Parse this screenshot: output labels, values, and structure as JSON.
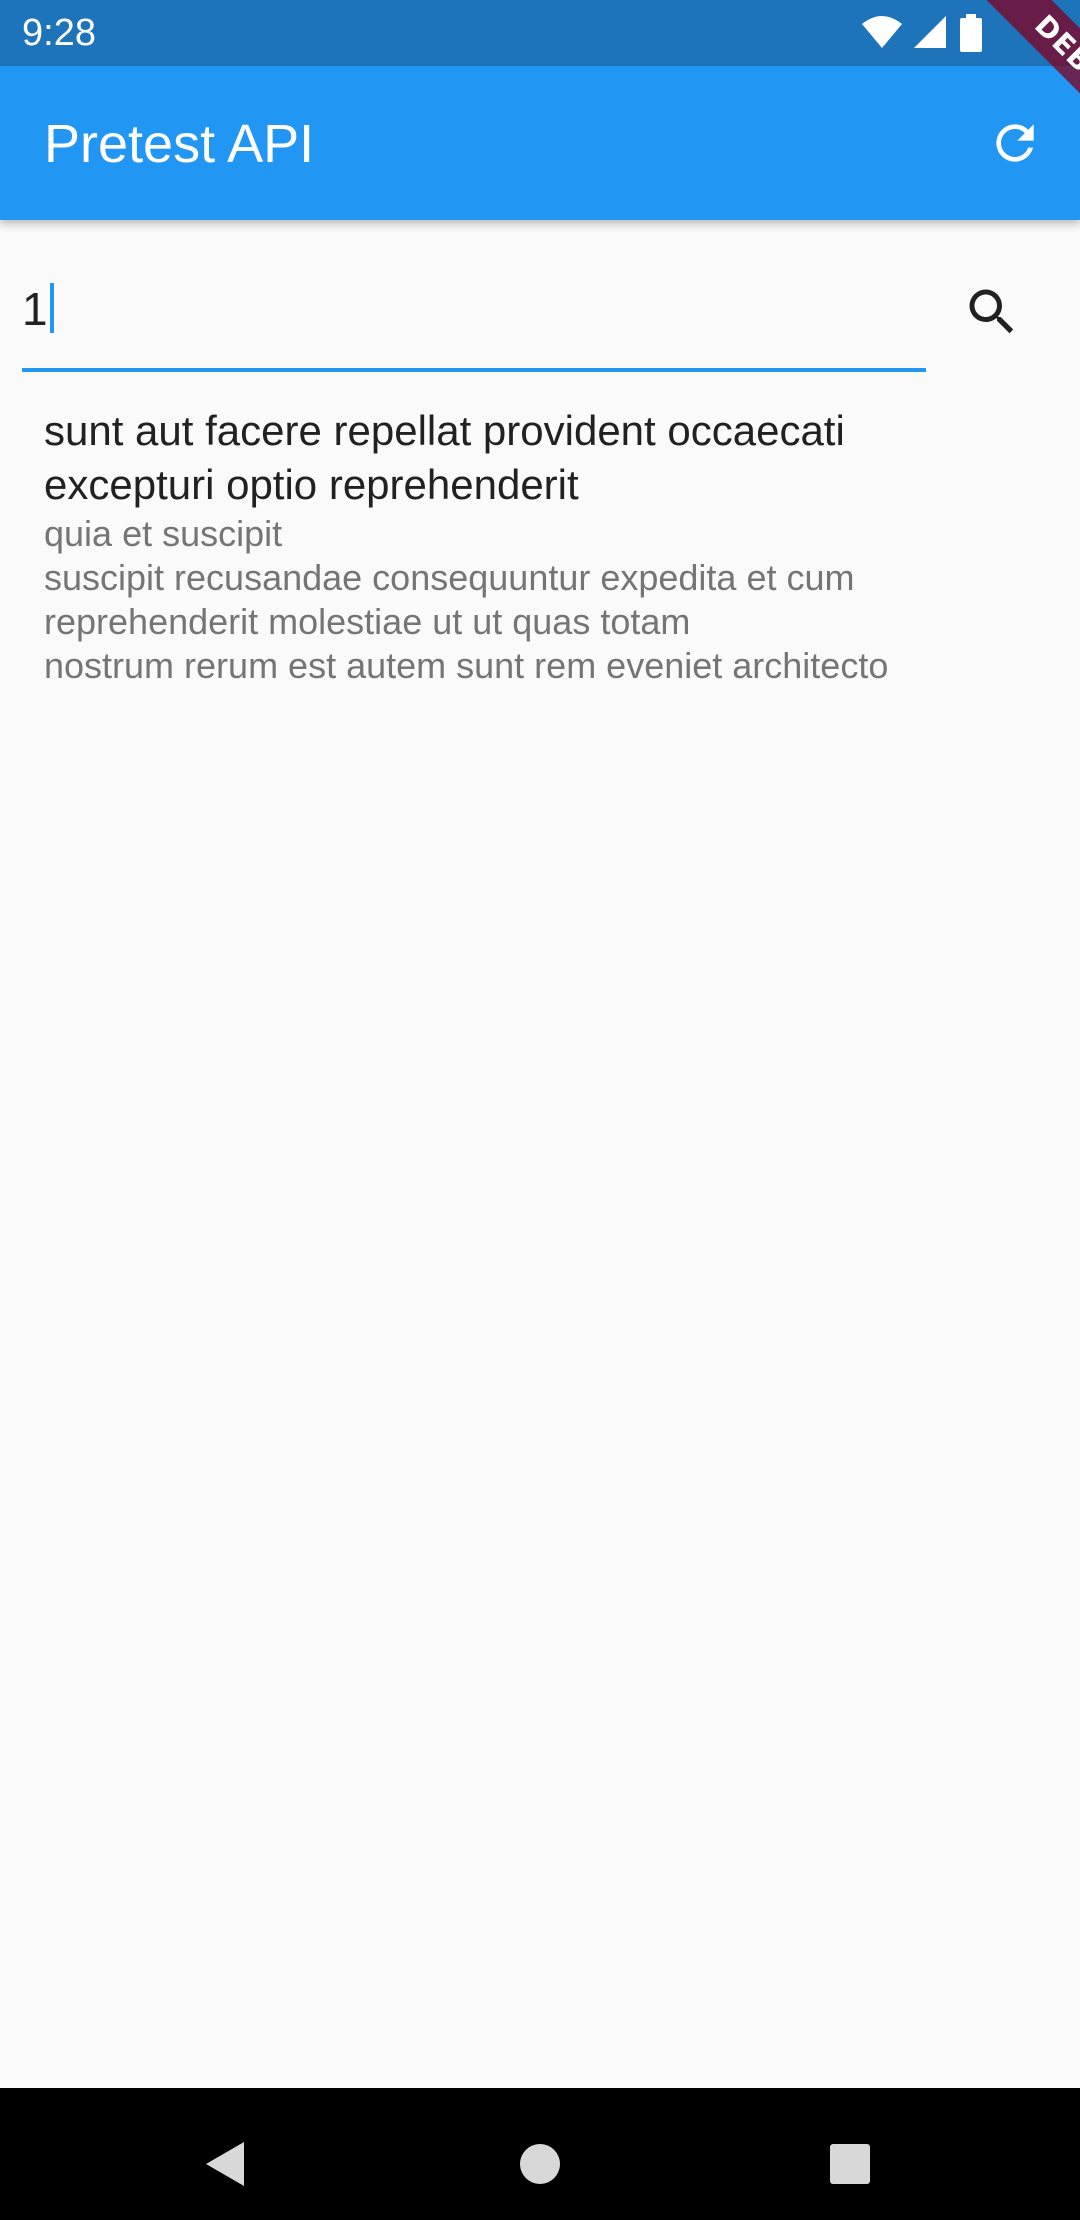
{
  "status_bar": {
    "time": "9:28",
    "icons": [
      "wifi-icon",
      "signal-icon",
      "battery-icon"
    ]
  },
  "app_bar": {
    "title": "Pretest API",
    "refresh_icon": "refresh-icon",
    "background_color": "#2196f3"
  },
  "debug_banner": {
    "label": "DEBUG"
  },
  "search": {
    "value": "1",
    "button_icon": "search-icon",
    "accent_color": "#2196f3"
  },
  "results": [
    {
      "title": "sunt aut facere repellat provident occaecati excepturi optio reprehenderit",
      "body": "quia et suscipit\nsuscipit recusandae consequuntur expedita et cum\nreprehenderit molestiae ut ut quas totam\nnostrum rerum est autem sunt rem eveniet architecto"
    }
  ],
  "nav_bar": {
    "buttons": [
      "back-icon",
      "home-icon",
      "recents-icon"
    ]
  }
}
